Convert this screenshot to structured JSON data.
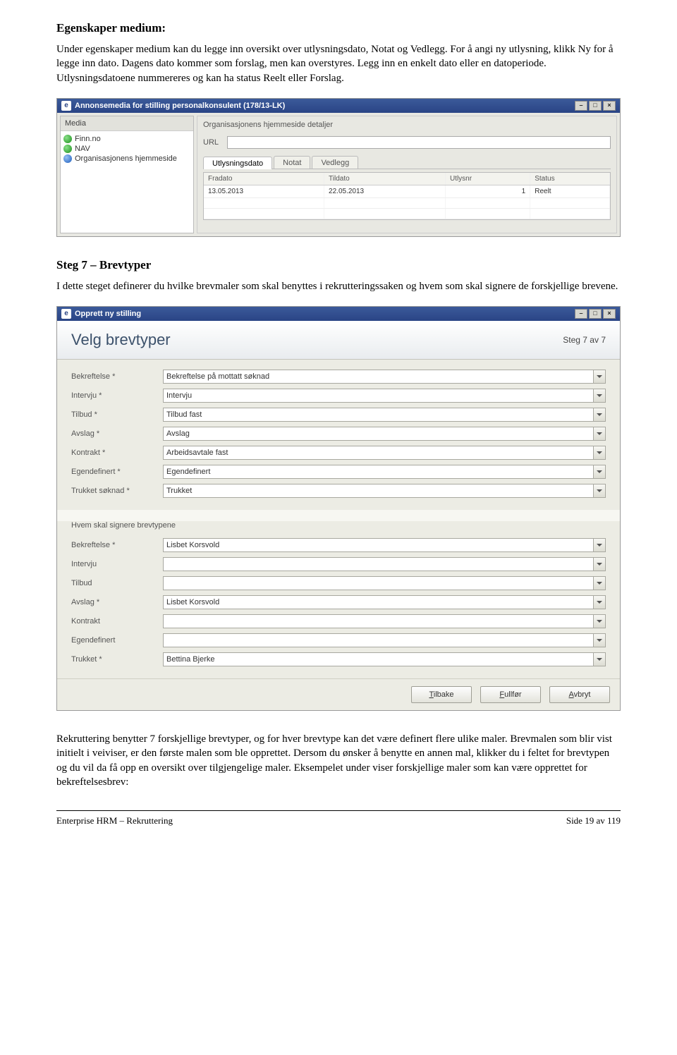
{
  "doc": {
    "heading1": "Egenskaper medium:",
    "para1": "Under egenskaper medium kan du legge inn oversikt over utlysningsdato, Notat og Vedlegg. For å angi ny utlysning, klikk Ny for å legge inn dato. Dagens dato kommer som forslag, men kan overstyres. Legg inn en enkelt dato eller en datoperiode. Utlysningsdatoene nummereres og kan ha status Reelt eller Forslag.",
    "heading2": "Steg 7 – Brevtyper",
    "para2": "I dette steget definerer du hvilke brevmaler som skal benyttes i rekrutteringssaken og hvem som skal signere de forskjellige brevene.",
    "para3": "Rekruttering benytter 7 forskjellige brevtyper, og for hver brevtype kan det være definert flere ulike maler. Brevmalen som blir vist initielt i veiviser, er den første malen som ble opprettet. Dersom du ønsker å benytte en annen mal, klikker du i feltet for brevtypen og du vil da få opp en oversikt over tilgjengelige maler. Eksempelet under viser forskjellige maler som kan være opprettet for bekreftelsesbrev:"
  },
  "window1": {
    "title": "Annonsemedia for stilling personalkonsulent (178/13-LK)",
    "mediaHeader": "Media",
    "mediaItems": [
      "Finn.no",
      "NAV",
      "Organisasjonens hjemmeside"
    ],
    "detailTitle": "Organisasjonens hjemmeside detaljer",
    "urlLabel": "URL",
    "tabs": [
      "Utlysningsdato",
      "Notat",
      "Vedlegg"
    ],
    "columns": [
      "Fradato",
      "Tildato",
      "Utlysnr",
      "Status"
    ],
    "row": {
      "fra": "13.05.2013",
      "til": "22.05.2013",
      "nr": "1",
      "status": "Reelt"
    }
  },
  "window2": {
    "title": "Opprett ny stilling",
    "wizardTitle": "Velg brevtyper",
    "step": "Steg 7 av 7",
    "fields1": [
      {
        "label": "Bekreftelse *",
        "value": "Bekreftelse på mottatt søknad"
      },
      {
        "label": "Intervju *",
        "value": "Intervju"
      },
      {
        "label": "Tilbud *",
        "value": "Tilbud fast"
      },
      {
        "label": "Avslag *",
        "value": "Avslag"
      },
      {
        "label": "Kontrakt *",
        "value": "Arbeidsavtale fast"
      },
      {
        "label": "Egendefinert *",
        "value": "Egendefinert"
      },
      {
        "label": "Trukket søknad *",
        "value": "Trukket"
      }
    ],
    "subheading": "Hvem skal signere brevtypene",
    "fields2": [
      {
        "label": "Bekreftelse *",
        "value": "Lisbet Korsvold"
      },
      {
        "label": "Intervju",
        "value": ""
      },
      {
        "label": "Tilbud",
        "value": ""
      },
      {
        "label": "Avslag *",
        "value": "Lisbet Korsvold"
      },
      {
        "label": "Kontrakt",
        "value": ""
      },
      {
        "label": "Egendefinert",
        "value": ""
      },
      {
        "label": "Trukket *",
        "value": "Bettina Bjerke"
      }
    ],
    "buttons": {
      "back": "Tilbake",
      "finish": "Fullfør",
      "cancel": "Avbryt"
    }
  },
  "footer": {
    "left": "Enterprise HRM – Rekruttering",
    "right": "Side 19 av 119"
  }
}
